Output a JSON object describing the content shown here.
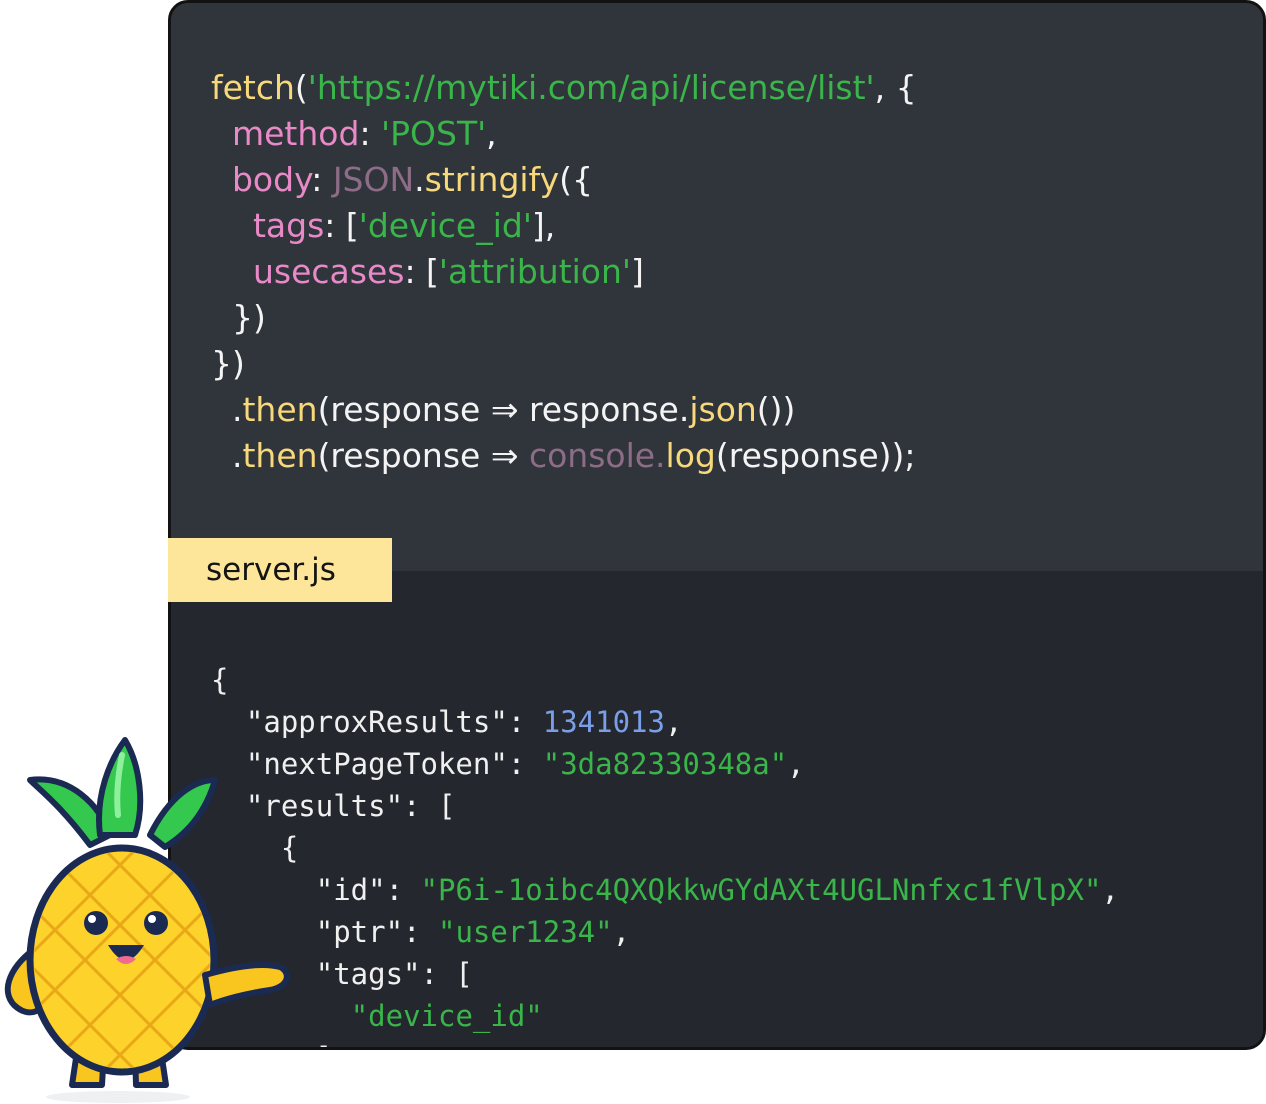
{
  "request_code": {
    "lines": [
      [
        {
          "t": "fetch",
          "c": "fn"
        },
        {
          "t": "(",
          "c": "pl"
        },
        {
          "t": "'https://mytiki.com/api/license/list'",
          "c": "str"
        },
        {
          "t": ", {",
          "c": "pl"
        }
      ],
      [
        {
          "t": "  ",
          "c": "pl"
        },
        {
          "t": "method",
          "c": "prop"
        },
        {
          "t": ": ",
          "c": "pl"
        },
        {
          "t": "'POST'",
          "c": "str"
        },
        {
          "t": ",",
          "c": "pl"
        }
      ],
      [
        {
          "t": "  ",
          "c": "pl"
        },
        {
          "t": "body",
          "c": "prop"
        },
        {
          "t": ": ",
          "c": "pl"
        },
        {
          "t": "JSON",
          "c": "obj"
        },
        {
          "t": ".",
          "c": "pl"
        },
        {
          "t": "stringify",
          "c": "fn"
        },
        {
          "t": "({",
          "c": "pl"
        }
      ],
      [
        {
          "t": "    ",
          "c": "pl"
        },
        {
          "t": "tags",
          "c": "prop"
        },
        {
          "t": ": [",
          "c": "pl"
        },
        {
          "t": "'device_id'",
          "c": "str"
        },
        {
          "t": "],",
          "c": "pl"
        }
      ],
      [
        {
          "t": "    ",
          "c": "pl"
        },
        {
          "t": "usecases",
          "c": "prop"
        },
        {
          "t": ": [",
          "c": "pl"
        },
        {
          "t": "'attribution'",
          "c": "str"
        },
        {
          "t": "]",
          "c": "pl"
        }
      ],
      [
        {
          "t": "  })",
          "c": "pl"
        }
      ],
      [
        {
          "t": "})",
          "c": "pl"
        }
      ],
      [
        {
          "t": "  .",
          "c": "pl"
        },
        {
          "t": "then",
          "c": "fn"
        },
        {
          "t": "(response ⇒ response.",
          "c": "pl"
        },
        {
          "t": "json",
          "c": "fn"
        },
        {
          "t": "())",
          "c": "pl"
        }
      ],
      [
        {
          "t": "  .",
          "c": "pl"
        },
        {
          "t": "then",
          "c": "fn"
        },
        {
          "t": "(response ⇒ ",
          "c": "pl"
        },
        {
          "t": "console.",
          "c": "obj"
        },
        {
          "t": "log",
          "c": "fn"
        },
        {
          "t": "(response));",
          "c": "pl"
        }
      ]
    ]
  },
  "file_tab": {
    "label": "server.js"
  },
  "response_code": {
    "lines": [
      [
        {
          "t": "{",
          "c": "pl"
        }
      ],
      [
        {
          "t": "  \"approxResults\": ",
          "c": "pl"
        },
        {
          "t": "1341013",
          "c": "num"
        },
        {
          "t": ",",
          "c": "pl"
        }
      ],
      [
        {
          "t": "  \"nextPageToken\": ",
          "c": "pl"
        },
        {
          "t": "\"3da82330348a\"",
          "c": "str"
        },
        {
          "t": ",",
          "c": "pl"
        }
      ],
      [
        {
          "t": "  \"results\": [",
          "c": "pl"
        }
      ],
      [
        {
          "t": "    {",
          "c": "pl"
        }
      ],
      [
        {
          "t": "      \"id\": ",
          "c": "pl"
        },
        {
          "t": "\"P6i-1oibc4QXQkkwGYdAXt4UGLNnfxc1fVlpX\"",
          "c": "str"
        },
        {
          "t": ",",
          "c": "pl"
        }
      ],
      [
        {
          "t": "      \"ptr\": ",
          "c": "pl"
        },
        {
          "t": "\"user1234\"",
          "c": "str"
        },
        {
          "t": ",",
          "c": "pl"
        }
      ],
      [
        {
          "t": "      \"tags\": [",
          "c": "pl"
        }
      ],
      [
        {
          "t": "        ",
          "c": "pl"
        },
        {
          "t": "\"device_id\"",
          "c": "str"
        }
      ],
      [
        {
          "t": "      ]",
          "c": "pl"
        }
      ]
    ]
  },
  "colors": {
    "card_border": "#121212",
    "top_panel": "#30353b",
    "bottom_panel": "#24282e",
    "function": "#f7d87a",
    "string": "#39b54a",
    "property": "#e889c8",
    "object": "#8d6c87",
    "number": "#7b9ee8",
    "tab": "#fde69a"
  },
  "mascot": {
    "icon": "pineapple-mascot-icon"
  }
}
